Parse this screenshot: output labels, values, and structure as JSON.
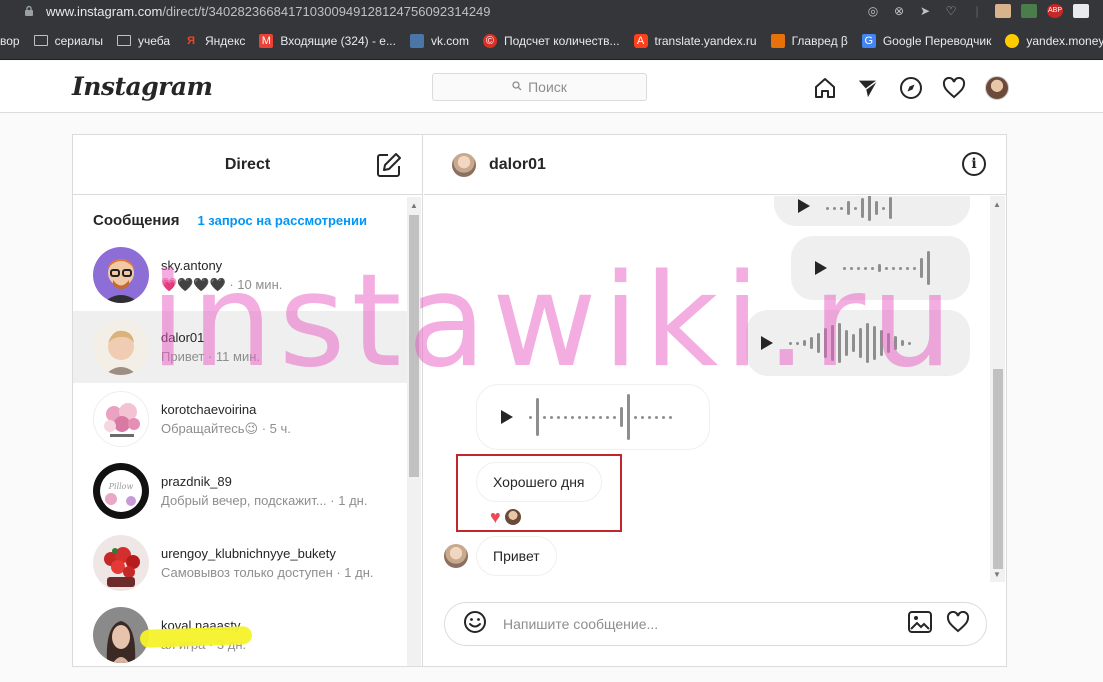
{
  "browser": {
    "url_domain": "www.instagram.com",
    "url_path": "/direct/t/340282366841710300949128124756092314249",
    "bookmarks": [
      {
        "label": "вор",
        "icon": "text-fragment",
        "color": "#35363a"
      },
      {
        "label": "сериалы",
        "icon": "folder-icon",
        "color": "#9aa0a6"
      },
      {
        "label": "учеба",
        "icon": "folder-icon",
        "color": "#9aa0a6"
      },
      {
        "label": "Яндекс",
        "icon": "yandex-icon",
        "color": "#fc3f1d"
      },
      {
        "label": "Входящие (324) - е...",
        "icon": "gmail-icon",
        "color": "#ea4335"
      },
      {
        "label": "vk.com",
        "icon": "vk-icon",
        "color": "#4a76a8"
      },
      {
        "label": "Подсчет количеств...",
        "icon": "counter-icon",
        "color": "#d93025"
      },
      {
        "label": "translate.yandex.ru",
        "icon": "translate-icon",
        "color": "#fc3f1d"
      },
      {
        "label": "Главред β",
        "icon": "glavred-icon",
        "color": "#e8710a"
      },
      {
        "label": "Google Переводчик",
        "icon": "google-translate-icon",
        "color": "#4285f4"
      },
      {
        "label": "yandex.money",
        "icon": "money-icon",
        "color": "#ffcc00"
      }
    ]
  },
  "header": {
    "logo": "Instagram",
    "search_placeholder": "Поиск"
  },
  "direct": {
    "title": "Direct",
    "messages_label": "Сообщения",
    "requests_label": "1 запрос на рассмотрении",
    "threads": [
      {
        "name": "sky.antony",
        "preview": "💗🖤🖤🖤",
        "time": " · 10 мин."
      },
      {
        "name": "dalor01",
        "preview": "Привет",
        "time": " · 11 мин."
      },
      {
        "name": "korotchaevoirina",
        "preview": "Обращайтесь😉",
        "time": " · 5 ч."
      },
      {
        "name": "prazdnik_89",
        "preview": "Добрый вечер, подскажит...",
        "time": " · 1 дн."
      },
      {
        "name": "urengoy_klubnichnyye_bukety",
        "preview": "Самовывоз только доступен",
        "time": " · 1 дн."
      },
      {
        "name": "koval.naaasty",
        "preview": "ая игра",
        "time": " · 3 дн."
      }
    ]
  },
  "chat": {
    "username": "dalor01",
    "messages": {
      "good_day": "Хорошего дня",
      "hello": "Привет"
    },
    "composer_placeholder": "Напишите сообщение..."
  },
  "watermark": "instawiki.ru"
}
